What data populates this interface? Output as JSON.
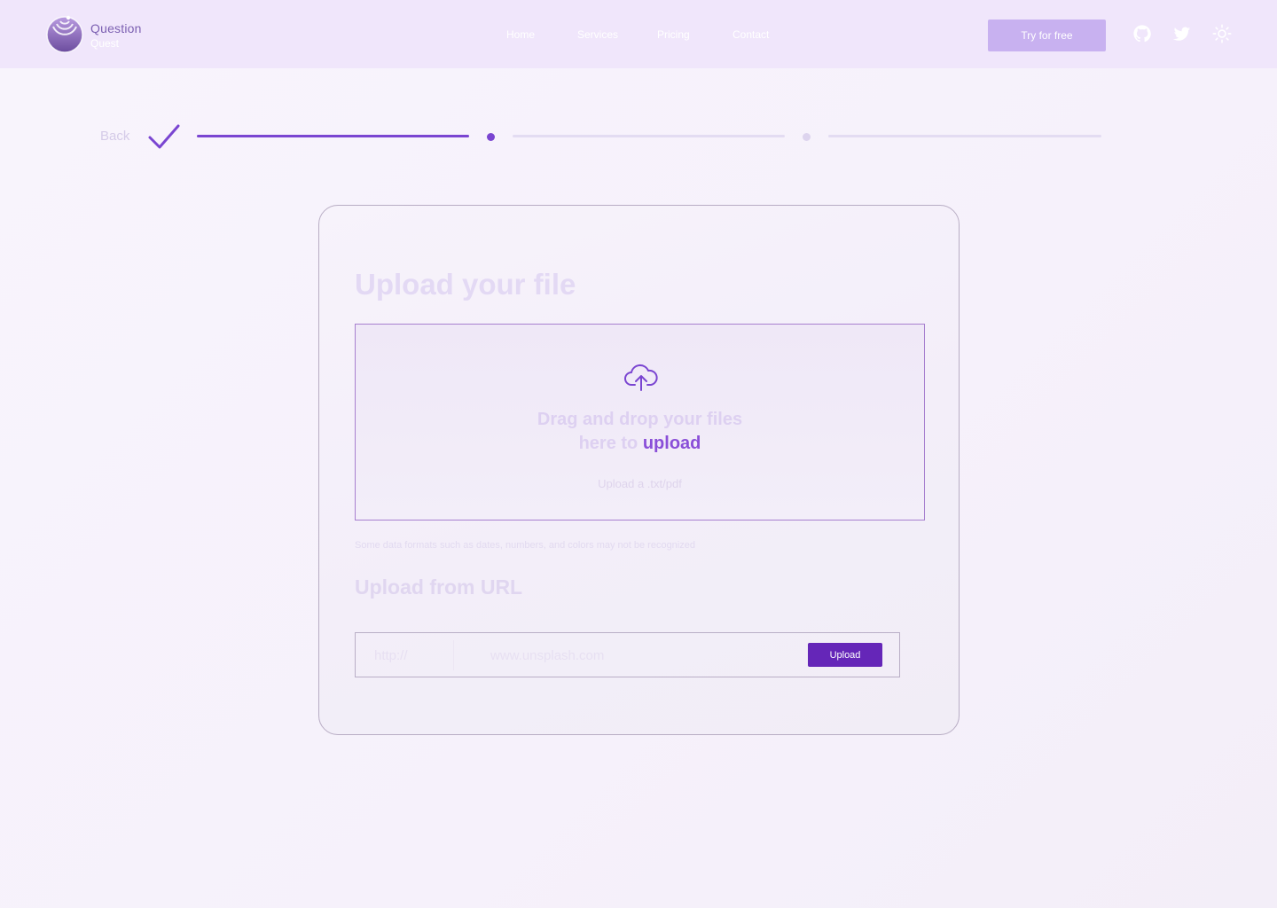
{
  "header": {
    "logo_line1": "Question",
    "logo_line2": "Quest",
    "nav": [
      {
        "label": "Home"
      },
      {
        "label": "Services"
      },
      {
        "label": "Pricing"
      },
      {
        "label": "Contact"
      }
    ],
    "cta_label": "Try for free",
    "icons": [
      "github-icon",
      "twitter-icon",
      "sun-icon"
    ]
  },
  "stepper": {
    "back_label": "Back",
    "current_step": 2,
    "total_steps": 3,
    "completed_color": "#7a45d1",
    "pending_color": "#e3dcf2"
  },
  "upload": {
    "title": "Upload your file",
    "drop_line1": "Drag and drop your files",
    "drop_line2_prefix": "here to ",
    "drop_line2_link": "upload",
    "hint": "Upload a .txt/pdf",
    "note": "Some data formats such as dates, numbers, and colors may not be recognized"
  },
  "url_upload": {
    "title": "Upload from URL",
    "protocol": "http://",
    "placeholder": "www.unsplash.com",
    "button_label": "Upload"
  },
  "colors": {
    "accent": "#6526b8",
    "link": "#8a4fd8",
    "header_bg": "#f0e6fb",
    "cta_bg": "#c8b1f0"
  }
}
